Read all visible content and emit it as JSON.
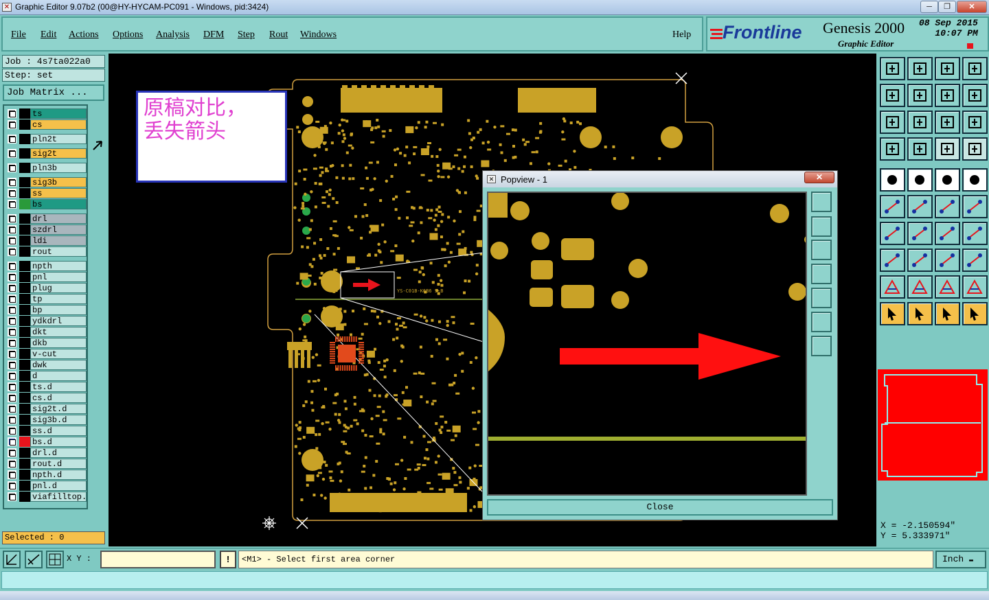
{
  "window": {
    "title": "Graphic Editor 9.07b2 (00@HY-HYCAM-PC091 - Windows, pid:3424)"
  },
  "menu": {
    "items": [
      "File",
      "Edit",
      "Actions",
      "Options",
      "Analysis",
      "DFM",
      "Step",
      "Rout",
      "Windows"
    ],
    "help": "Help"
  },
  "logo": {
    "brand": "Frontline",
    "product": "Genesis 2000",
    "subtitle": "Graphic Editor",
    "date": "08 Sep 2015",
    "time": "10:07 PM"
  },
  "job": {
    "job_label": "Job : 4s7ta022a0",
    "step_label": "Step: set",
    "matrix_button": "Job Matrix ..."
  },
  "layers": [
    {
      "name": "ts",
      "color": "#1f9a84"
    },
    {
      "name": "cs",
      "color": "#f5c04a"
    },
    {
      "name": "pln2t",
      "color": "#bfe4e0"
    },
    {
      "name": "sig2t",
      "color": "#f5c04a"
    },
    {
      "name": "pln3b",
      "color": "#bfe4e0"
    },
    {
      "name": "sig3b",
      "color": "#f5c04a"
    },
    {
      "name": "ss",
      "color": "#f5c04a"
    },
    {
      "name": "bs",
      "color": "#1f9a84",
      "swatch": "#2a9a3a"
    },
    {
      "name": "drl",
      "color": "#a9b6bd"
    },
    {
      "name": "szdrl",
      "color": "#a9b6bd"
    },
    {
      "name": "ldi",
      "color": "#a9b6bd"
    },
    {
      "name": "rout",
      "color": "#bfe4e0"
    },
    {
      "name": "npth",
      "color": "#bfe4e0"
    },
    {
      "name": "pnl",
      "color": "#bfe4e0"
    },
    {
      "name": "plug",
      "color": "#bfe4e0"
    },
    {
      "name": "tp",
      "color": "#bfe4e0"
    },
    {
      "name": "bp",
      "color": "#bfe4e0"
    },
    {
      "name": "ydkdrl",
      "color": "#bfe4e0"
    },
    {
      "name": "dkt",
      "color": "#bfe4e0"
    },
    {
      "name": "dkb",
      "color": "#bfe4e0"
    },
    {
      "name": "v-cut",
      "color": "#bfe4e0"
    },
    {
      "name": "dwk",
      "color": "#bfe4e0"
    },
    {
      "name": "d",
      "color": "#bfe4e0"
    },
    {
      "name": "ts.d",
      "color": "#bfe4e0"
    },
    {
      "name": "cs.d",
      "color": "#bfe4e0"
    },
    {
      "name": "sig2t.d",
      "color": "#bfe4e0"
    },
    {
      "name": "sig3b.d",
      "color": "#bfe4e0"
    },
    {
      "name": "ss.d",
      "color": "#bfe4e0"
    },
    {
      "name": "bs.d",
      "color": "#bfe4e0",
      "swatch": "#e8141c",
      "active": true
    },
    {
      "name": "drl.d",
      "color": "#bfe4e0"
    },
    {
      "name": "rout.d",
      "color": "#bfe4e0"
    },
    {
      "name": "npth.d",
      "color": "#bfe4e0"
    },
    {
      "name": "pnl.d",
      "color": "#bfe4e0"
    },
    {
      "name": "viafilltop.d",
      "color": "#bfe4e0"
    }
  ],
  "selected": "Selected : 0",
  "annotation": {
    "line1": "原稿对比，",
    "line2": "丢失箭头"
  },
  "popview": {
    "title": "Popview - 1",
    "close_label": "Close"
  },
  "coords": {
    "x": "X  =  -2.150594\"",
    "y": "Y  =  5.333971\""
  },
  "bottom": {
    "xy_label": "X Y :",
    "xy_value": "",
    "message": "<M1> - Select first area corner",
    "units": "Inch"
  },
  "colors": {
    "board": "#c9a227",
    "panel": "#7fc9c2",
    "arrow": "#ff1010"
  }
}
